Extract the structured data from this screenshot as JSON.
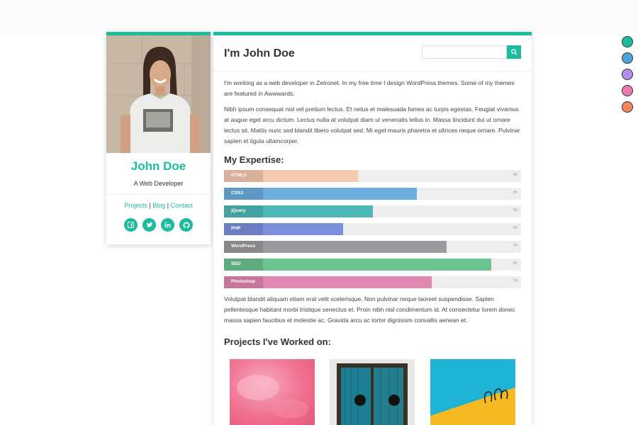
{
  "colors": {
    "accent": "#1abc9c",
    "swatches": [
      "#1abc9c",
      "#4aa3df",
      "#b48eed",
      "#ea7ab0",
      "#f0865a"
    ]
  },
  "profile": {
    "name": "John Doe",
    "subtitle": "A Web Developer",
    "links": [
      "Projects",
      "Blog",
      "Contact"
    ],
    "link_separator": "|",
    "socials": [
      "facebook-icon",
      "twitter-icon",
      "linkedin-icon",
      "github-icon"
    ]
  },
  "header": {
    "title": "I'm John Doe",
    "search_placeholder": ""
  },
  "intro": {
    "paragraph1": "I'm working as a web developer in Zetronet. In my free time I design WordPress themes. Some of my themes are featured in Awwwards.",
    "paragraph2": "Nibh ipsum consequat nisl vel pretium lectus. Et netus et malesuada fames ac turpis egestas. Feugiat vivamus at augue eget arcu dictum. Lectus nulla at volutpat diam ut venenatis tellus in. Massa tincidunt dui ut ornare lectus sit. Mattis nunc sed blandit libero volutpat sed. Mi eget mauris pharetra et ultrices neque ornare. Pulvinar sapien et ligula ullamcorper."
  },
  "expertise": {
    "heading": "My Expertise:",
    "skills": [
      {
        "label": "HTML5",
        "value": 45,
        "color": "#f6c9b1"
      },
      {
        "label": "CSS3",
        "value": 65,
        "color": "#6caedf"
      },
      {
        "label": "jQuery",
        "value": 50,
        "color": "#4db8b8"
      },
      {
        "label": "PHP",
        "value": 40,
        "color": "#7c8fdc"
      },
      {
        "label": "WordPress",
        "value": 75,
        "color": "#9c9a9e"
      },
      {
        "label": "SEO",
        "value": 90,
        "color": "#6cc490"
      },
      {
        "label": "Photoshop",
        "value": 70,
        "color": "#e486b2"
      }
    ]
  },
  "outro": {
    "paragraph": "Volutpat blandit aliquam etiam erat velit scelerisque. Non pulvinar neque laoreet suspendisse. Sapien pellentesque habitant morbi tristique senectus et. Proin nibh nisl condimentum id. At consectetur lorem donec massa sapien faucibus et molestie ac. Gravida arcu ac tortor dignissim convallis aenean et."
  },
  "projects": {
    "heading": "Projects I've Worked on:"
  }
}
